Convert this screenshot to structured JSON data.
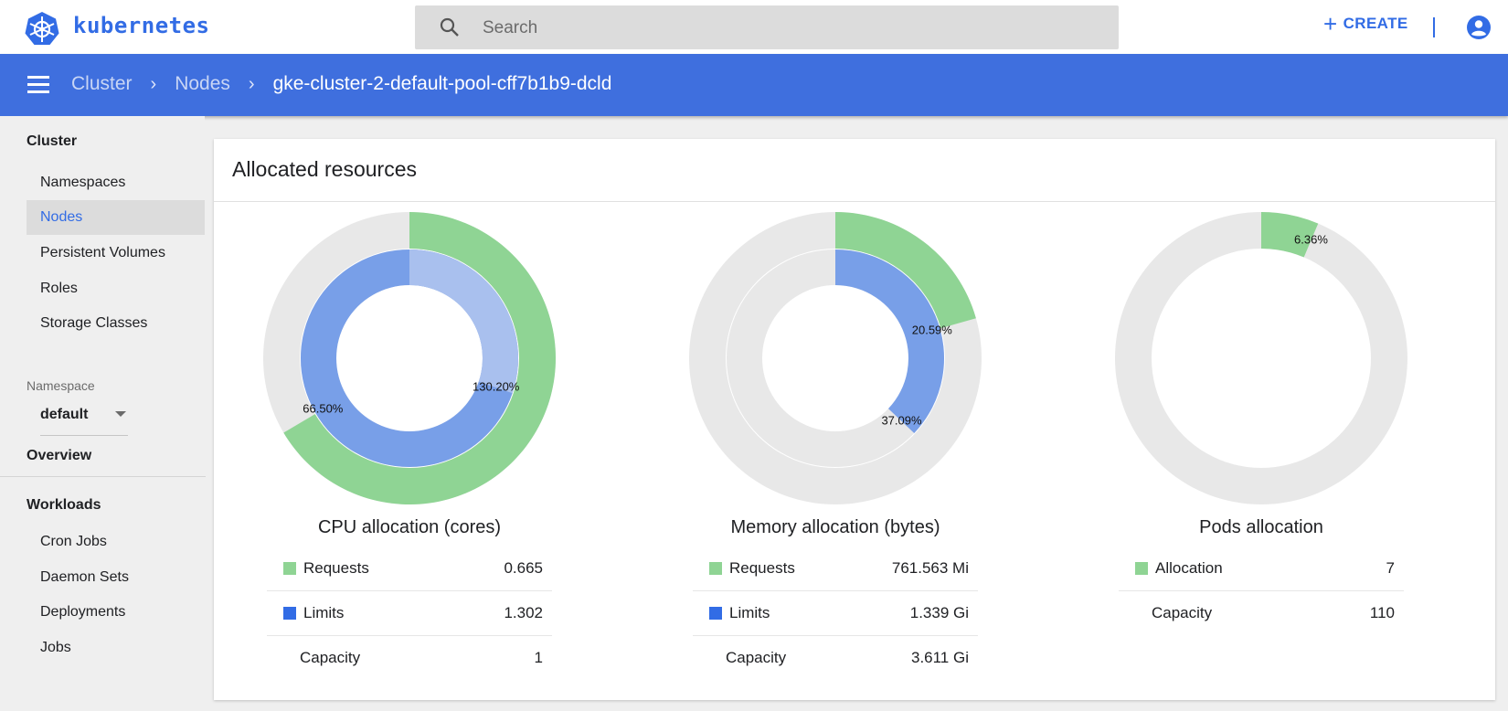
{
  "app": {
    "brand": "kubernetes"
  },
  "search": {
    "placeholder": "Search"
  },
  "header": {
    "create_label": "CREATE"
  },
  "breadcrumb": {
    "items": [
      "Cluster",
      "Nodes"
    ],
    "current": "gke-cluster-2-default-pool-cff7b1b9-dcld"
  },
  "sidebar": {
    "cluster_heading": "Cluster",
    "cluster_items": [
      "Namespaces",
      "Nodes",
      "Persistent Volumes",
      "Roles",
      "Storage Classes"
    ],
    "active_item": "Nodes",
    "namespace_label": "Namespace",
    "namespace_value": "default",
    "overview": "Overview",
    "workloads_heading": "Workloads",
    "workload_items": [
      "Cron Jobs",
      "Daemon Sets",
      "Deployments",
      "Jobs"
    ]
  },
  "card": {
    "title": "Allocated resources"
  },
  "colors": {
    "requests": "#8fd494",
    "limits": "#789fe8",
    "limits_hatched": "#a9c0ee",
    "empty": "#e8e8e8",
    "accent": "#326ce5",
    "bar": "#3f6fde"
  },
  "charts": [
    {
      "title": "CPU allocation (cores)",
      "requests_pct": 66.5,
      "requests_label": "66.50%",
      "limits_pct": 130.2,
      "limits_label": "130.20%",
      "rows": [
        {
          "name": "Requests",
          "value": "0.665",
          "swatch": "requests"
        },
        {
          "name": "Limits",
          "value": "1.302",
          "swatch": "limits"
        },
        {
          "name": "Capacity",
          "value": "1"
        }
      ]
    },
    {
      "title": "Memory allocation (bytes)",
      "requests_pct": 20.59,
      "requests_label": "20.59%",
      "limits_pct": 37.09,
      "limits_label": "37.09%",
      "rows": [
        {
          "name": "Requests",
          "value": "761.563 Mi",
          "swatch": "requests"
        },
        {
          "name": "Limits",
          "value": "1.339 Gi",
          "swatch": "limits"
        },
        {
          "name": "Capacity",
          "value": "3.611 Gi"
        }
      ]
    },
    {
      "title": "Pods allocation",
      "requests_pct": 6.36,
      "requests_label": "6.36%",
      "rows": [
        {
          "name": "Allocation",
          "value": "7",
          "swatch": "requests"
        },
        {
          "name": "Capacity",
          "value": "110"
        }
      ]
    }
  ]
}
